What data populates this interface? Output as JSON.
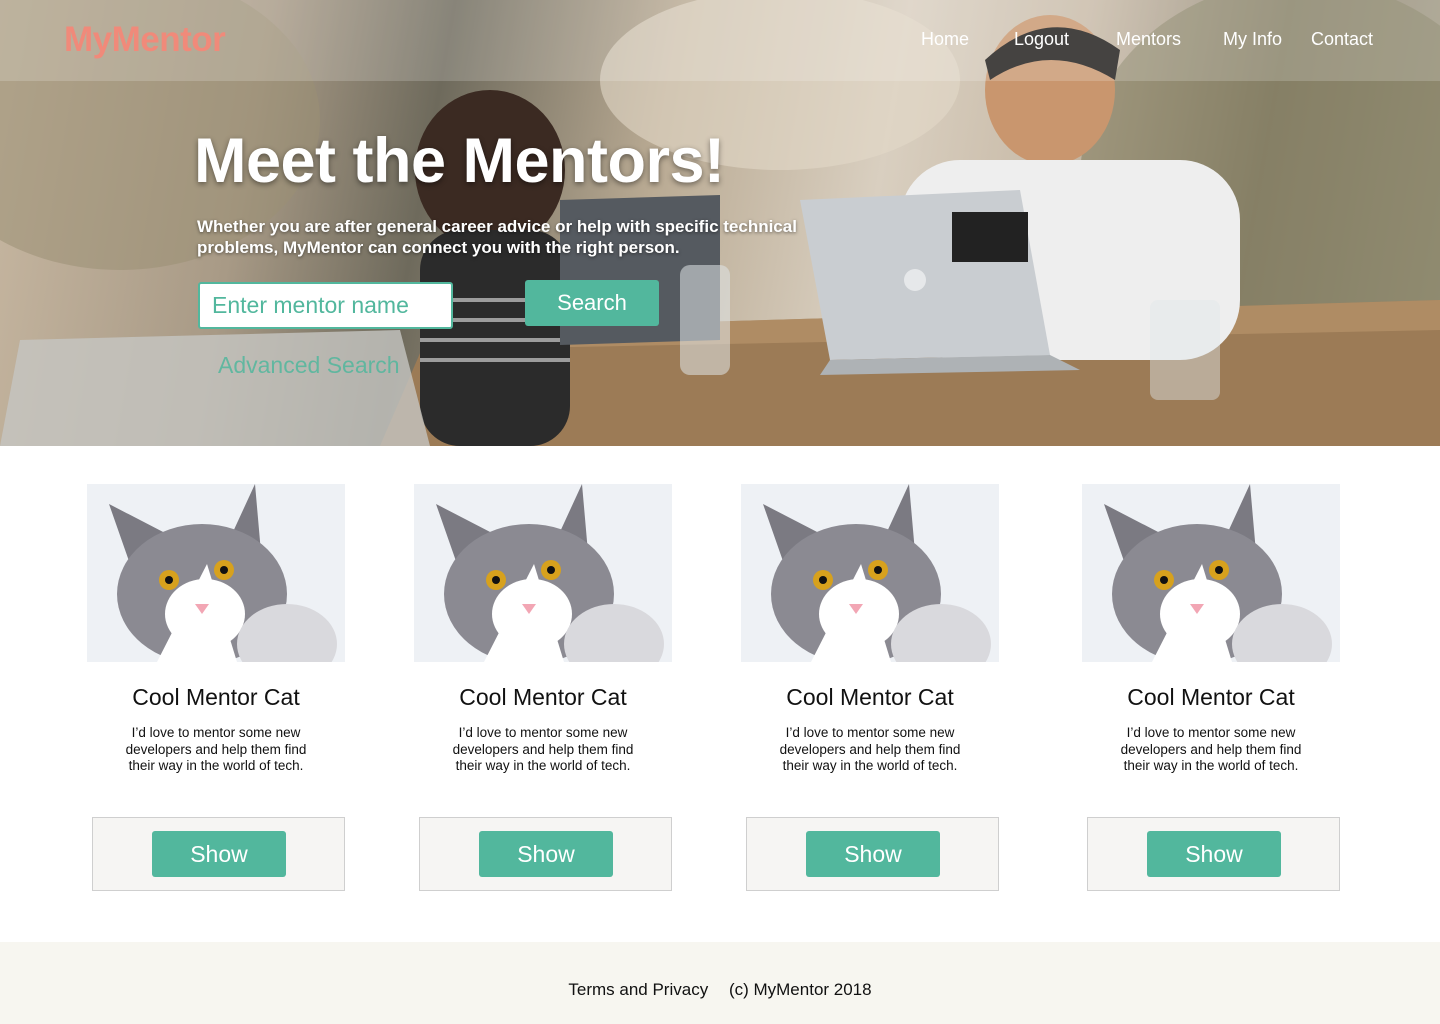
{
  "brand": "MyMentor",
  "nav": {
    "home": "Home",
    "logout": "Logout",
    "mentors": "Mentors",
    "my_info": "My Info",
    "contact": "Contact"
  },
  "hero": {
    "title": "Meet the Mentors!",
    "subtitle": "Whether you are after general career advice or help with specific technical problems, MyMentor can connect you with the right person.",
    "search_placeholder": "Enter mentor name",
    "search_button": "Search",
    "advanced_search": "Advanced Search"
  },
  "cards": [
    {
      "name": "Cool Mentor Cat",
      "description": "I’d love to mentor some new developers and help them find their way in the world of tech.",
      "button": "Show"
    },
    {
      "name": "Cool Mentor Cat",
      "description": "I’d love to mentor some new developers and help them find their way in the world of tech.",
      "button": "Show"
    },
    {
      "name": "Cool Mentor Cat",
      "description": "I’d love to mentor some new developers and help them find their way in the world of tech.",
      "button": "Show"
    },
    {
      "name": "Cool Mentor Cat",
      "description": "I’d love to mentor some new developers and help them find their way in the world of tech.",
      "button": "Show"
    }
  ],
  "footer": {
    "terms": "Terms and Privacy",
    "copyright": "(c) MyMentor 2018"
  },
  "colors": {
    "accent": "#52b79d",
    "brand": "#f08a7a",
    "footer_bg": "#f7f6f0"
  }
}
